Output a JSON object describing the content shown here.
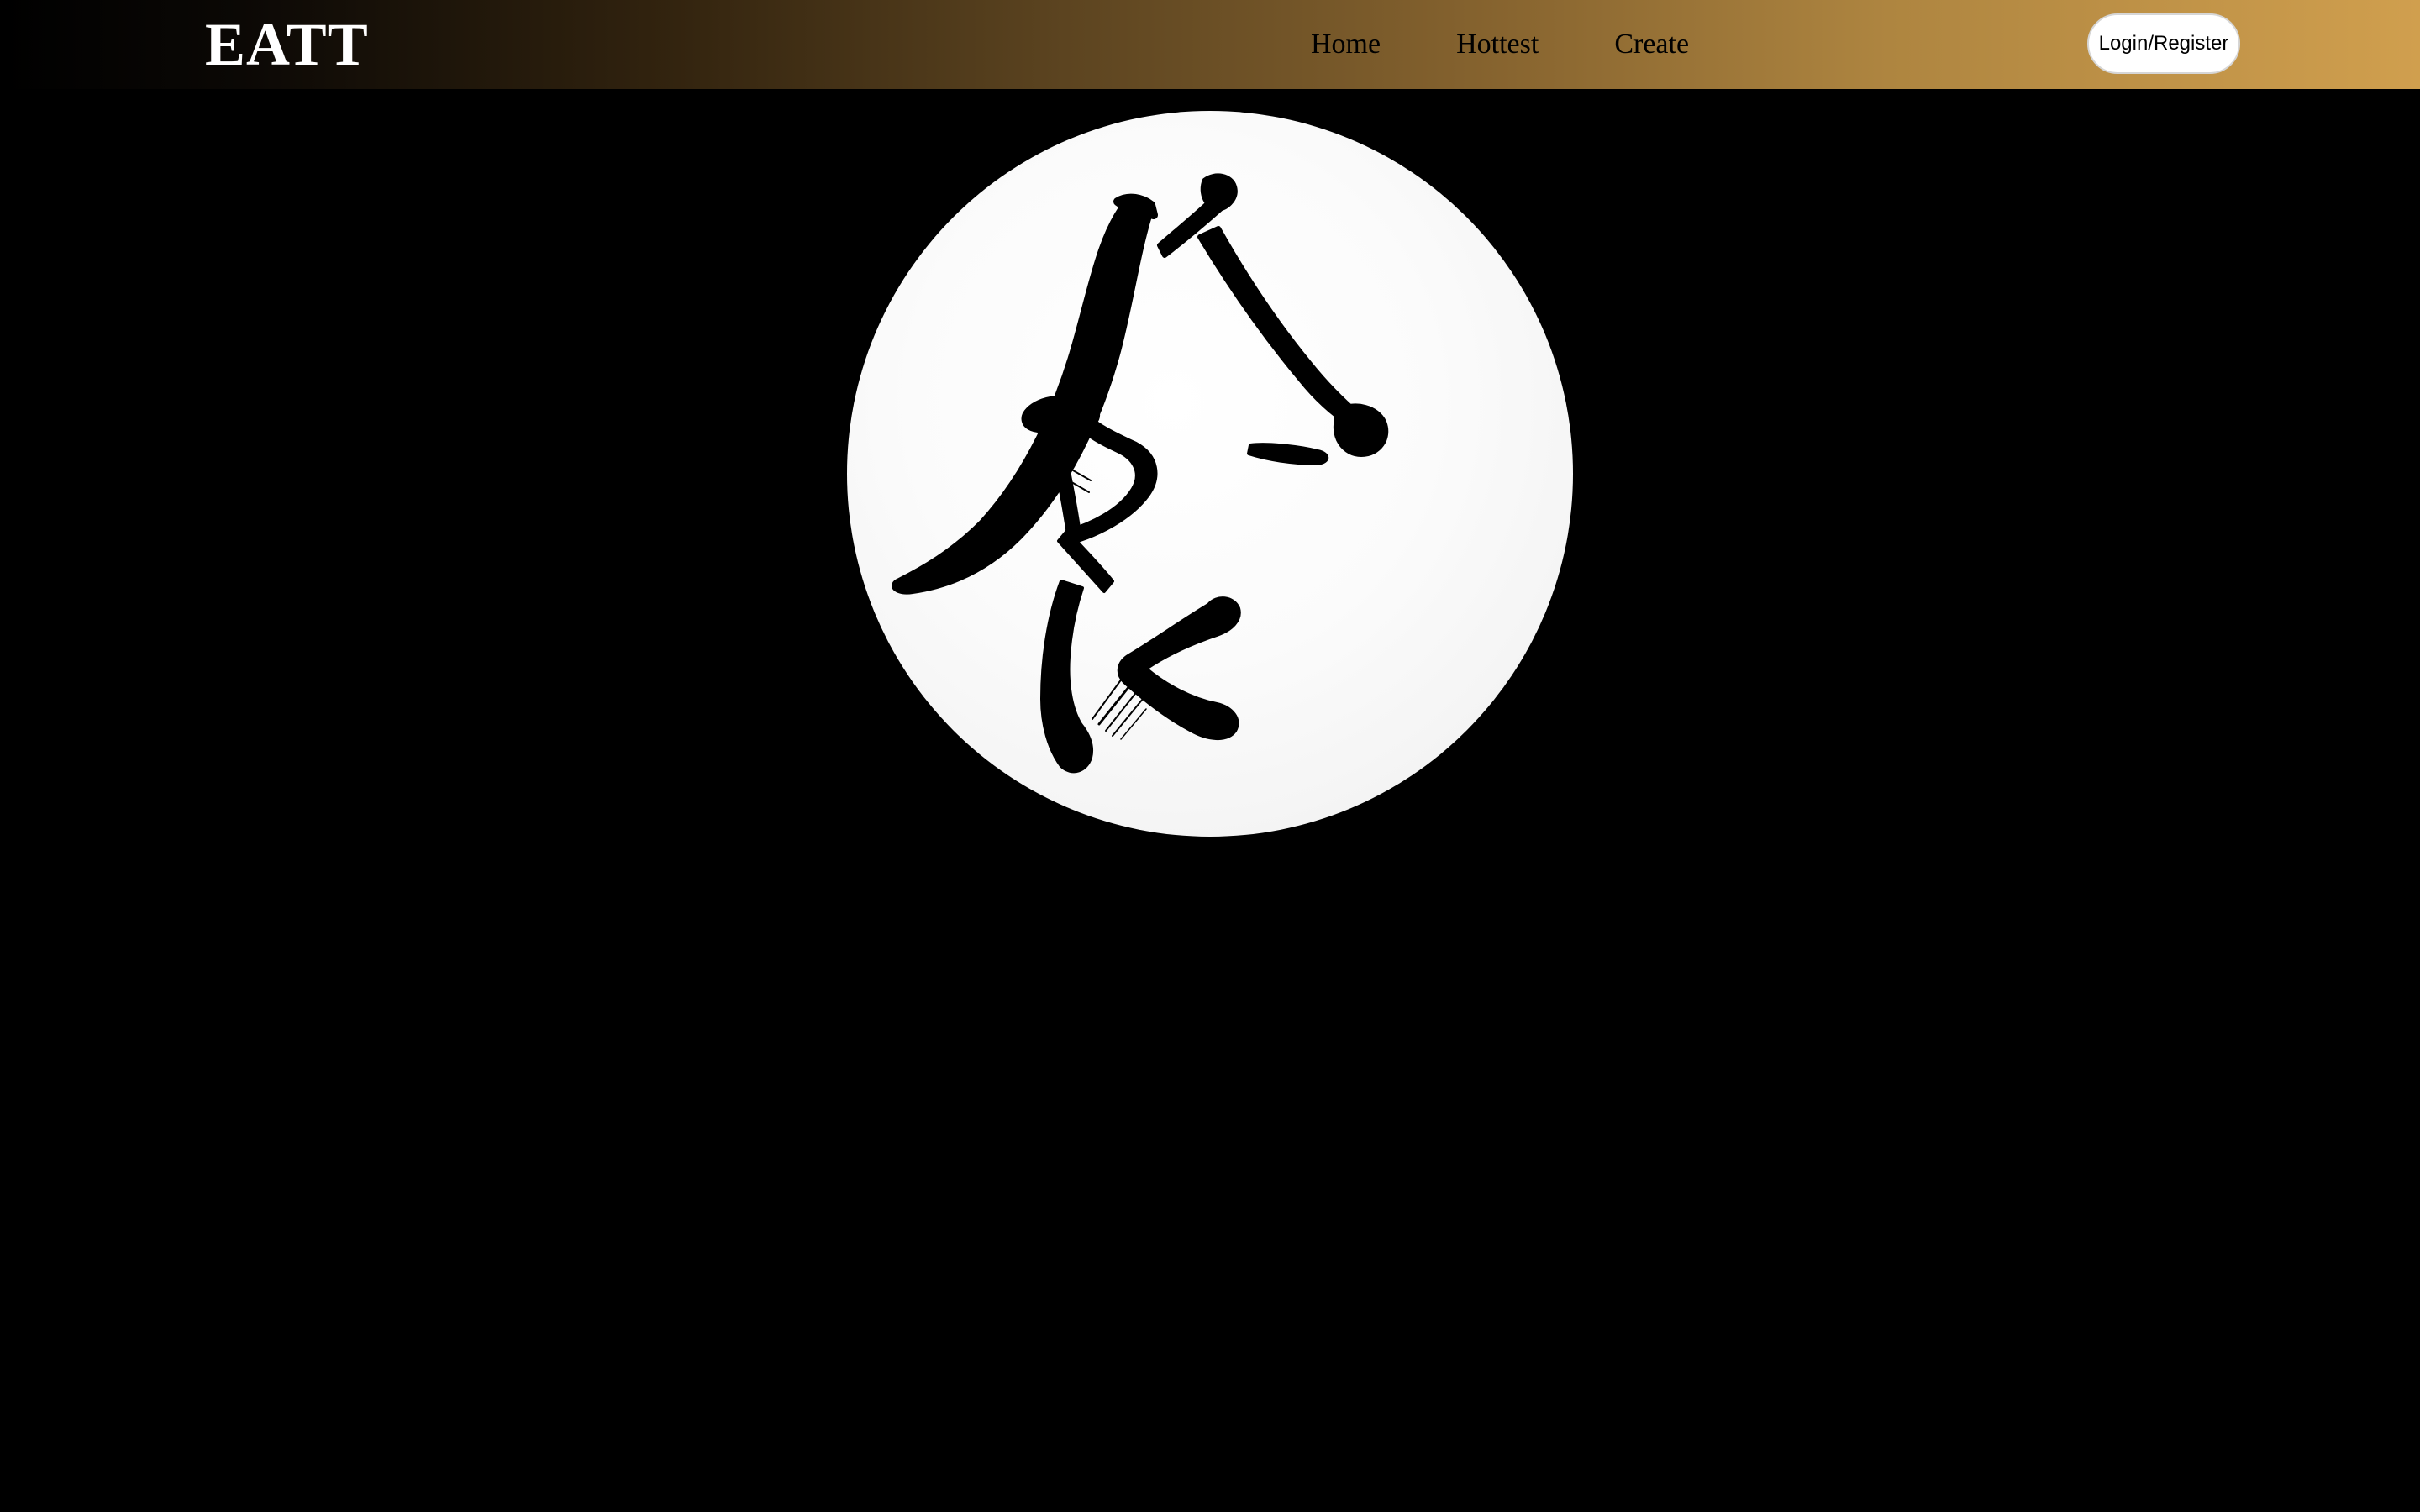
{
  "header": {
    "logo": "EATT",
    "nav": [
      {
        "label": "Home"
      },
      {
        "label": "Hottest"
      },
      {
        "label": "Create"
      }
    ],
    "login_label": "Login/Register"
  },
  "hero": {
    "calligraphy_char": "食",
    "image_icon": "calligraphy-emblem"
  },
  "colors": {
    "page_background": "#000000",
    "header_gradient_start": "#000000",
    "header_gradient_end": "#d09f4e",
    "logo_text": "#ffffff",
    "nav_text": "#000000",
    "circle_fill": "#f8f8f8",
    "ink": "#000000"
  }
}
